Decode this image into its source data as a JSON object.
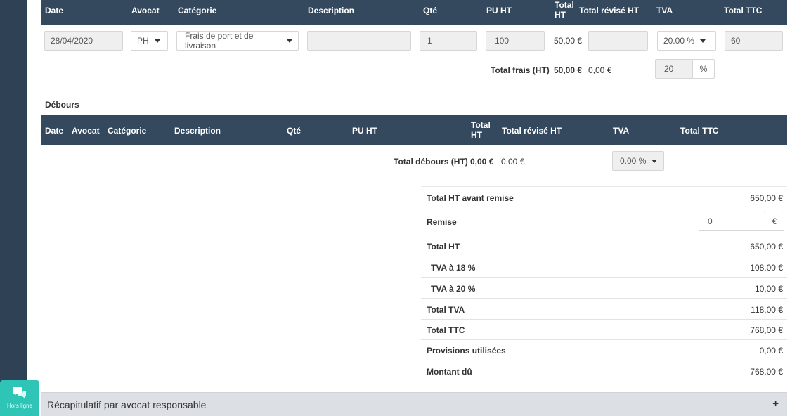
{
  "frais": {
    "headers": {
      "date": "Date",
      "avocat": "Avocat",
      "categorie": "Catégorie",
      "description": "Description",
      "qte": "Qté",
      "pu_ht": "PU HT",
      "total_ht_l1": "Total",
      "total_ht_l2": "HT",
      "total_revise_ht": "Total révisé HT",
      "tva": "TVA",
      "total_ttc": "Total TTC"
    },
    "row": {
      "date": "28/04/2020",
      "avocat": "PH",
      "categorie": "Frais de port et de livraison",
      "description": "",
      "qte": "1",
      "pu_ht": "100",
      "total_ht": "50,00 €",
      "total_revise_ht": "",
      "tva": "20.00 %",
      "total_ttc": "60"
    },
    "total_label": "Total frais (HT)",
    "total_value": "50,00 €",
    "total_revise": "0,00 €",
    "percent_value": "20",
    "percent_unit": "%"
  },
  "debours": {
    "section_title": "Débours",
    "headers": {
      "date": "Date",
      "avocat": "Avocat",
      "categorie": "Catégorie",
      "description": "Description",
      "qte": "Qté",
      "pu_ht": "PU HT",
      "total_ht_l1": "Total",
      "total_ht_l2": "HT",
      "total_revise_ht": "Total révisé HT",
      "tva": "TVA",
      "total_ttc": "Total TTC"
    },
    "total_label": "Total débours (HT)",
    "total_value": "0,00 €",
    "total_revise": "0,00 €",
    "tva_select": "0.00 %"
  },
  "summary": {
    "total_ht_avant_remise_label": "Total HT avant remise",
    "total_ht_avant_remise_value": "650,00 €",
    "remise_label": "Remise",
    "remise_value": "0",
    "remise_unit": "€",
    "total_ht_label": "Total HT",
    "total_ht_value": "650,00 €",
    "tva18_label": "TVA à 18 %",
    "tva18_value": "108,00 €",
    "tva20_label": "TVA à 20 %",
    "tva20_value": "10,00 €",
    "total_tva_label": "Total TVA",
    "total_tva_value": "118,00 €",
    "total_ttc_label": "Total TTC",
    "total_ttc_value": "768,00 €",
    "provisions_label": "Provisions utilisées",
    "provisions_value": "0,00 €",
    "montant_du_label": "Montant dû",
    "montant_du_value": "768,00 €"
  },
  "recap": {
    "title": "Récapitulatif par avocat responsable",
    "expand": "+"
  },
  "chat": {
    "label": "Hors ligne",
    "icon": "chat-bubbles-icon",
    "color": "#2ec4b6"
  },
  "colors": {
    "header_bg": "#34495e",
    "sidebar_bg": "#2f4255"
  }
}
